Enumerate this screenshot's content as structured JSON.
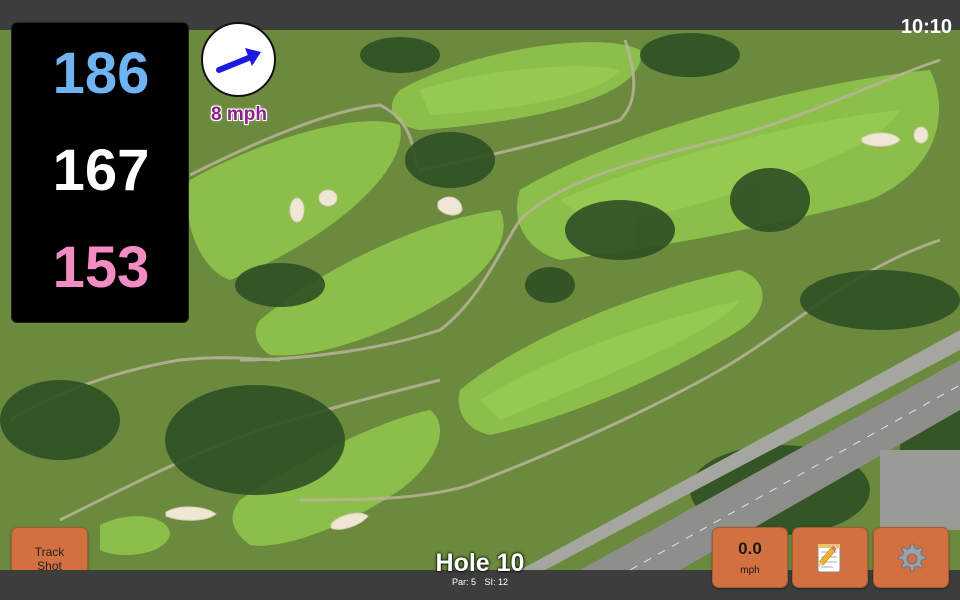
{
  "status": {
    "time": "10:10"
  },
  "distances": {
    "back": "186",
    "middle": "167",
    "front": "153"
  },
  "wind": {
    "speed_label": "8 mph"
  },
  "track_button": {
    "line1": "Track",
    "line2": "Shot"
  },
  "wind_button": {
    "value": "0.0",
    "unit": "mph"
  },
  "hole": {
    "title": "Hole 10",
    "par": "Par: 5",
    "si": "SI: 12"
  },
  "icons": {
    "wind_direction": "arrow-right-icon",
    "notes": "notepad-icon",
    "settings": "gear-icon"
  },
  "colors": {
    "back_distance": "#6fb3f2",
    "middle_distance": "#ffffff",
    "front_distance": "#f48cc4",
    "button": "#d2703f",
    "wind_arrow": "#1a1ae0"
  }
}
